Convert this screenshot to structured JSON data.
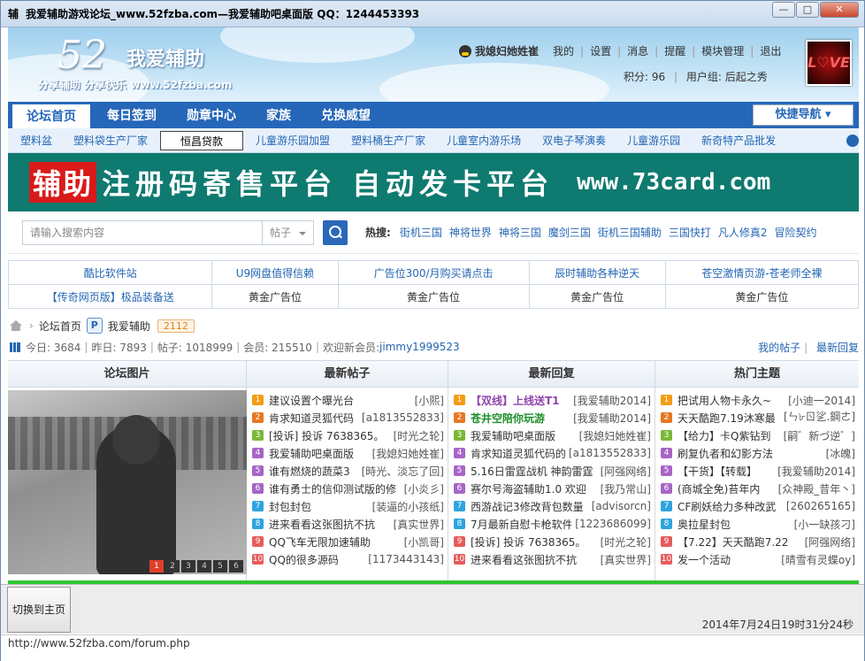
{
  "window": {
    "title": "我爱辅助游戏论坛_www.52fzba.com—我爱辅助吧桌面版    QQ：1244453393",
    "app_icon": "辅"
  },
  "header": {
    "logo_num": "52",
    "logo_text": "我爱辅助",
    "slogan": "分享辅助  分享快乐  www.52fzba.com",
    "username": "我媳妇她姓崔",
    "links": [
      "我的",
      "设置",
      "消息",
      "提醒",
      "模块管理",
      "退出"
    ],
    "points": "积分: 96",
    "usergroup": "用户组: 后起之秀",
    "avatar_text": "L♡VE"
  },
  "nav": {
    "tabs": [
      "论坛首页",
      "每日签到",
      "勋章中心",
      "家族",
      "兑换威望"
    ],
    "quick": "快捷导航"
  },
  "subnav": [
    "塑料盆",
    "塑料袋生产厂家",
    "恒昌贷款",
    "儿童游乐园加盟",
    "塑料桶生产厂家",
    "儿童室内游乐场",
    "双电子琴演奏",
    "儿童游乐园",
    "新奇特产品批发"
  ],
  "banner": {
    "label": "辅助",
    "text": "注册码寄售平台  自动发卡平台",
    "url": "www.73card.com"
  },
  "search": {
    "placeholder": "请输入搜索内容",
    "type": "帖子",
    "hot_label": "热搜:",
    "hot": [
      "街机三国",
      "神将世界",
      "神将三国",
      "魔剑三国",
      "街机三国辅助",
      "三国快打",
      "凡人修真2",
      "冒险契约"
    ]
  },
  "ads": {
    "row1": [
      "酷比软件站",
      "U9网盘值得信赖",
      "广告位300/月购买请点击",
      "辰时辅助各种逆天",
      "苍空激情页游-苍老师全裸"
    ],
    "row2": [
      "【传奇网页版】极品装备送",
      "黄金广告位",
      "黄金广告位",
      "黄金广告位",
      "黄金广告位"
    ]
  },
  "crumb": {
    "home": "论坛首页",
    "forum": "我爱辅助",
    "count": "2112"
  },
  "stats": {
    "today": "今日: 3684",
    "yesterday": "昨日: 7893",
    "posts": "帖子: 1018999",
    "members": "会员: 215510",
    "welcome": "欢迎新会员:",
    "newmember": "jimmy1999523",
    "mine": "我的帖子",
    "latest": "最新回复"
  },
  "columns": {
    "pic": "论坛图片",
    "new": "最新帖子",
    "reply": "最新回复",
    "hot": "热门主题"
  },
  "pic_pages": [
    "1",
    "2",
    "3",
    "4",
    "5",
    "6"
  ],
  "newposts": [
    {
      "t": "建议设置个曝光台",
      "a": "[小熙]"
    },
    {
      "t": "肯求知道灵狐代码",
      "a": "[a1813552833]"
    },
    {
      "t": "[投诉] 投诉  7638365。",
      "a": "[时光之轮]"
    },
    {
      "t": "我爱辅助吧桌面版",
      "a": "[我媳妇她姓崔]"
    },
    {
      "t": "谁有燃烧的蔬菜3",
      "a": "[時光、淡忘了回]"
    },
    {
      "t": "谁有勇士的信仰测试版的修",
      "a": "[小炎彡]"
    },
    {
      "t": "封包封包",
      "a": "[装逼的小孩纸]"
    },
    {
      "t": "进来看看这张图抗不抗",
      "a": "[真实世界]"
    },
    {
      "t": "QQ飞车无限加速辅助",
      "a": "[小凯哥]"
    },
    {
      "t": "QQ的很多源码",
      "a": "[1173443143]"
    }
  ],
  "replies": [
    {
      "t": "【双线】上线送T1",
      "a": "[我爱辅助2014]",
      "style": "hl"
    },
    {
      "t": "苍井空陪你玩游",
      "a": "[我爱辅助2014]",
      "style": "hl2"
    },
    {
      "t": "我爱辅助吧桌面版",
      "a": "[我媳妇她姓崔]",
      "style": ""
    },
    {
      "t": "肯求知道灵狐代码的",
      "a": "[a1813552833]",
      "style": ""
    },
    {
      "t": "5.16日雷霆战机 神韵雷霆",
      "a": "[阿强网络]",
      "style": ""
    },
    {
      "t": "赛尔号海盗辅助1.0 欢迎",
      "a": "[我乃常山]",
      "style": ""
    },
    {
      "t": "西游战记3修改背包数量",
      "a": "[advisorcn]",
      "style": ""
    },
    {
      "t": "7月最新自慰卡枪软件",
      "a": "[1223686099]",
      "style": ""
    },
    {
      "t": "[投诉] 投诉  7638365。",
      "a": "[时光之轮]",
      "style": ""
    },
    {
      "t": "进来看看这张图抗不抗",
      "a": "[真实世界]",
      "style": ""
    }
  ],
  "hottopics": [
    {
      "t": "把试用人物卡永久~",
      "a": "[小迪一2014]"
    },
    {
      "t": "天天酷跑7.19沐寒最",
      "a": "[ㄣ৮ㄖ乷.鋼ㄜ]"
    },
    {
      "t": "【给力】卡Q紫钻到",
      "a": "[嗣゛新づ逆゛]"
    },
    {
      "t": "刷复仇者和幻影方法",
      "a": "[冰魄]"
    },
    {
      "t": "【干货】【转载】",
      "a": "[我爱辅助2014]"
    },
    {
      "t": "(商城全免)苔年内",
      "a": "[众神殿_昔年丶]"
    },
    {
      "t": "CF刷妖给力多种改武",
      "a": "[260265165]"
    },
    {
      "t": "奥拉星封包",
      "a": "[小一缺孩刁]"
    },
    {
      "t": "【7.22】天天酷跑7.22",
      "a": "[阿强网络]"
    },
    {
      "t": "发一个活动",
      "a": "[晴雪有灵蝶oy]"
    }
  ],
  "bottom": {
    "switch": "切换到主页",
    "time": "2014年7月24日19时31分24秒"
  },
  "status": "http://www.52fzba.com/forum.php"
}
